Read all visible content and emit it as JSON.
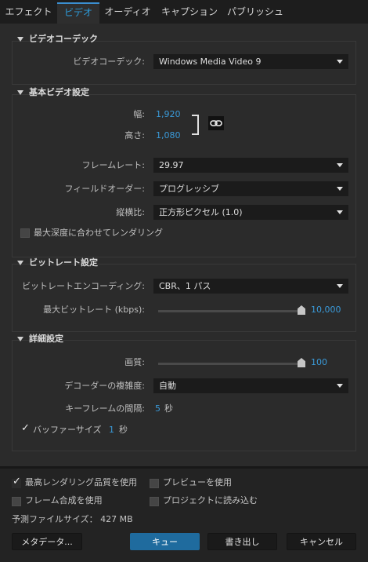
{
  "tabs": [
    "エフェクト",
    "ビデオ",
    "オーディオ",
    "キャプション",
    "パブリッシュ"
  ],
  "active_tab": "ビデオ",
  "video_codec": {
    "title": "ビデオコーデック",
    "codec_label": "ビデオコーデック:",
    "codec_value": "Windows Media Video 9"
  },
  "basic_video": {
    "title": "基本ビデオ設定",
    "width_label": "幅:",
    "width_value": "1,920",
    "height_label": "高さ:",
    "height_value": "1,080",
    "link_icon": "link-icon",
    "frame_rate_label": "フレームレート:",
    "frame_rate_value": "29.97",
    "field_order_label": "フィールドオーダー:",
    "field_order_value": "プログレッシブ",
    "aspect_label": "縦横比:",
    "aspect_value": "正方形ピクセル (1.0)",
    "max_depth_label": "最大深度に合わせてレンダリング",
    "max_depth_checked": false
  },
  "bitrate": {
    "title": "ビットレート設定",
    "encoding_label": "ビットレートエンコーディング:",
    "encoding_value": "CBR、1 パス",
    "max_bitrate_label": "最大ビットレート (kbps):",
    "max_bitrate_value": "10,000",
    "max_bitrate_fraction": 1.0
  },
  "advanced": {
    "title": "詳細設定",
    "quality_label": "画質:",
    "quality_value": "100",
    "quality_fraction": 1.0,
    "decoder_label": "デコーダーの複雑度:",
    "decoder_value": "自動",
    "keyframe_label": "キーフレームの間隔:",
    "keyframe_value": "5",
    "keyframe_unit": "秒",
    "buffer_label": "バッファーサイズ",
    "buffer_value": "1",
    "buffer_unit": "秒",
    "buffer_checked": true
  },
  "bottom": {
    "max_render_quality": "最高レンダリング品質を使用",
    "max_render_quality_checked": true,
    "use_previews": "プレビューを使用",
    "use_previews_checked": false,
    "frame_blending": "フレーム合成を使用",
    "frame_blending_checked": false,
    "import_into_project": "プロジェクトに読み込む",
    "import_into_project_checked": false,
    "estimated_size": "予測ファイルサイズ：  427 MB"
  },
  "buttons": {
    "metadata": "メタデータ...",
    "queue": "キュー",
    "export": "書き出し",
    "cancel": "キャンセル"
  },
  "colors": {
    "accent": "#3a9ad9",
    "primary_button": "#1f6b9e"
  }
}
